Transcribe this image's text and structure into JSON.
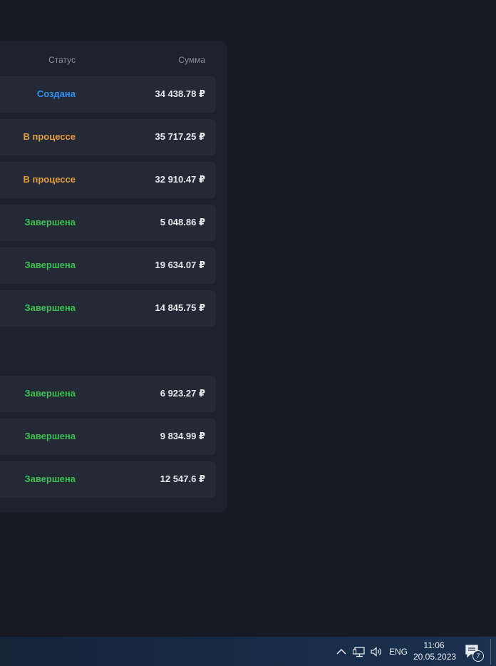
{
  "table": {
    "columns": {
      "status": "Статус",
      "amount": "Сумма"
    },
    "rows": [
      {
        "status": "Создана",
        "status_kind": "created",
        "amount": "34 438.78 ₽"
      },
      {
        "status": "В процессе",
        "status_kind": "progress",
        "amount": "35 717.25 ₽"
      },
      {
        "status": "В процессе",
        "status_kind": "progress",
        "amount": "32 910.47 ₽"
      },
      {
        "status": "Завершена",
        "status_kind": "done",
        "amount": "5 048.86 ₽"
      },
      {
        "status": "Завершена",
        "status_kind": "done",
        "amount": "19 634.07 ₽"
      },
      {
        "status": "Завершена",
        "status_kind": "done",
        "amount": "14 845.75 ₽"
      },
      {
        "status": "Завершена",
        "status_kind": "done",
        "amount": "6 923.27 ₽"
      },
      {
        "status": "Завершена",
        "status_kind": "done",
        "amount": "9 834.99 ₽"
      },
      {
        "status": "Завершена",
        "status_kind": "done",
        "amount": "12 547.6 ₽"
      }
    ]
  },
  "colors": {
    "created": "#2e8ff0",
    "progress": "#e89a3c",
    "done": "#3cc04f",
    "background": "#151a24",
    "panel": "#1b212d",
    "row": "#242a35"
  },
  "taskbar": {
    "language": "ENG",
    "time": "11:06",
    "date": "20.05.2023",
    "notification_count": "7",
    "icons": [
      "chevron-up-icon",
      "network-icon",
      "volume-icon",
      "notification-icon"
    ]
  }
}
